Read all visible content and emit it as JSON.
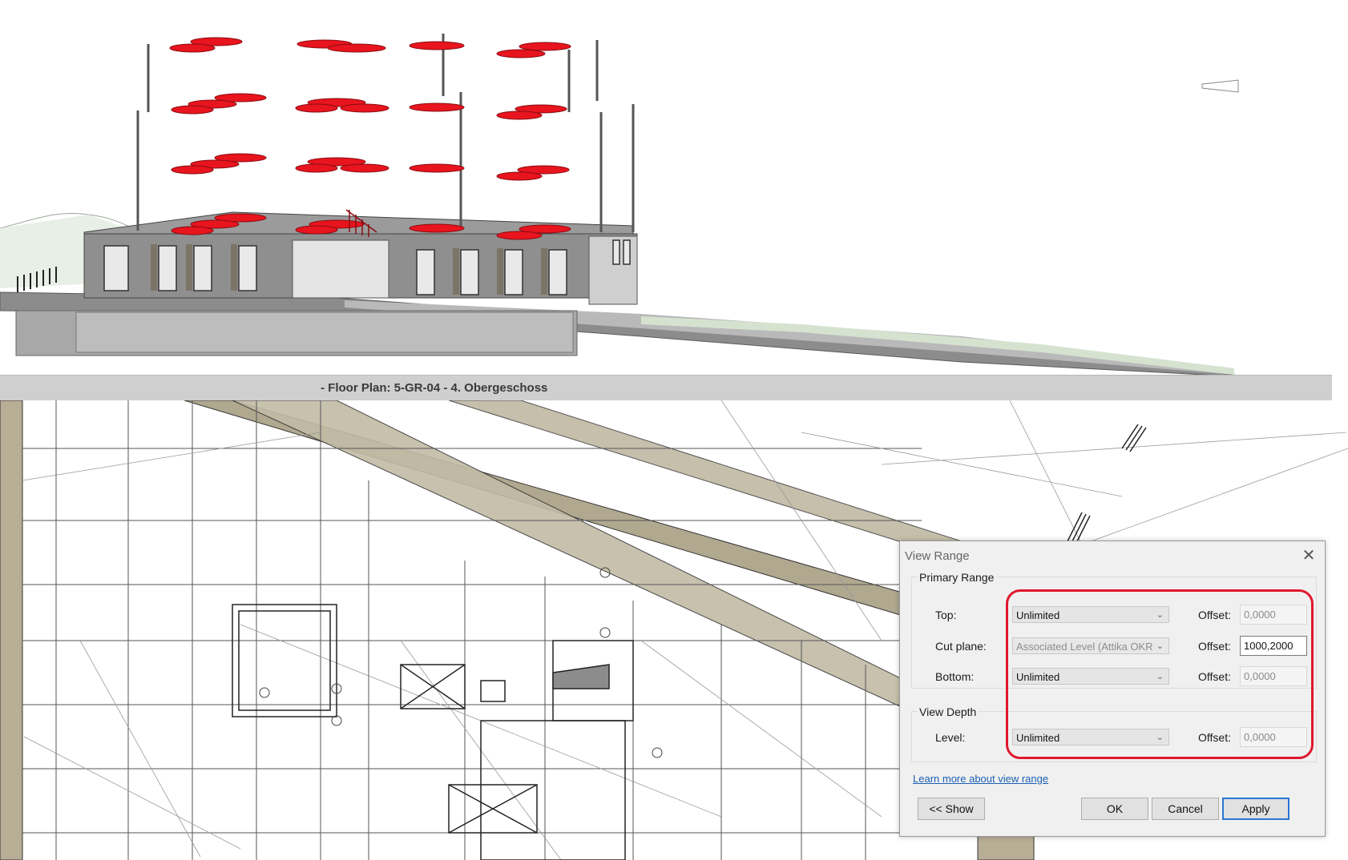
{
  "view_title": "- Floor Plan: 5-GR-04 - 4. Obergeschoss",
  "dialog": {
    "title": "View Range",
    "close_glyph": "✕",
    "primary_range_label": "Primary Range",
    "rows": [
      {
        "label": "Top:",
        "value": "Unlimited",
        "disabled": false,
        "offset_label": "Offset:",
        "offset": "0,0000",
        "offset_active": false
      },
      {
        "label": "Cut plane:",
        "value": "Associated Level (Attika OKR",
        "disabled": true,
        "offset_label": "Offset:",
        "offset": "1000,2000",
        "offset_active": true
      },
      {
        "label": "Bottom:",
        "value": "Unlimited",
        "disabled": false,
        "offset_label": "Offset:",
        "offset": "0,0000",
        "offset_active": false
      }
    ],
    "view_depth_label": "View Depth",
    "depth_row": {
      "label": "Level:",
      "value": "Unlimited",
      "offset_label": "Offset:",
      "offset": "0,0000"
    },
    "learn_more": "Learn more about view range",
    "buttons": {
      "show": "<< Show",
      "ok": "OK",
      "cancel": "Cancel",
      "apply": "Apply"
    }
  },
  "colors": {
    "highlight": "#e0182d",
    "red_elements": "#e8141e",
    "link": "#1a5fb4"
  }
}
